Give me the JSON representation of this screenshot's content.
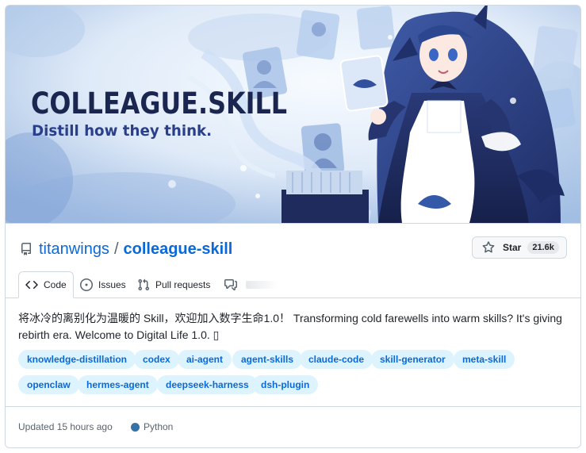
{
  "banner": {
    "title": "COLLEAGUE.SKILL",
    "subtitle": "Distill how they think."
  },
  "repo": {
    "owner": "titanwings",
    "separator": "/",
    "name": "colleague-skill",
    "icon": "repo-icon"
  },
  "star": {
    "label": "Star",
    "count": "21.6k",
    "icon": "star-icon"
  },
  "tabs": [
    {
      "label": "Code",
      "icon": "code-icon",
      "active": true
    },
    {
      "label": "Issues",
      "icon": "issue-opened-icon"
    },
    {
      "label": "Pull requests",
      "icon": "git-pull-request-icon"
    },
    {
      "label": "",
      "icon": "comment-discussion-icon"
    }
  ],
  "description": "将冰冷的离别化为温暖的 Skill，欢迎加入数字生命1.0！ Transforming cold farewells into warm skills? It's giving rebirth era. Welcome to Digital Life 1.0. ▯",
  "topics": [
    "knowledge-distillation",
    "codex",
    "ai-agent",
    "agent-skills",
    "claude-code",
    "skill-generator",
    "meta-skill",
    "openclaw",
    "hermes-agent",
    "deepseek-harness",
    "dsh-plugin"
  ],
  "footer": {
    "updated": "Updated 15 hours ago",
    "language": "Python",
    "language_color": "#3572A5"
  },
  "colors": {
    "link": "#0969da",
    "topic_bg": "#ddf4ff",
    "border": "#d1d9e0",
    "banner_navy": "#1b2650"
  }
}
